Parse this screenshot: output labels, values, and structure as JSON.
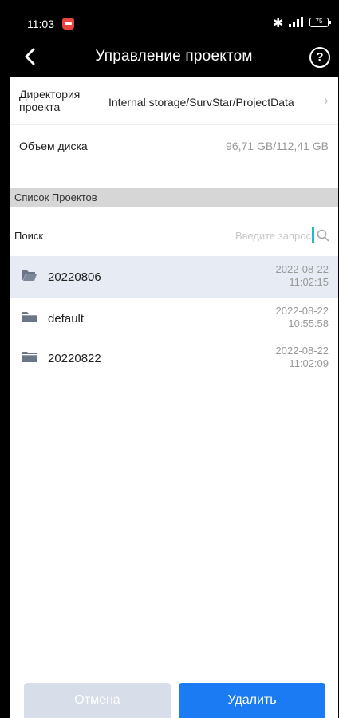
{
  "status_bar": {
    "time": "11:03",
    "battery": "75"
  },
  "header": {
    "title": "Управление проектом",
    "help": "?"
  },
  "directory": {
    "label": "Директория проекта",
    "value": "Internal storage/SurvStar/ProjectData"
  },
  "disk": {
    "label": "Объем диска",
    "value": "96,71 GB/112,41 GB"
  },
  "projects_section": {
    "title": "Список Проектов"
  },
  "search": {
    "label": "Поиск",
    "placeholder": "Введите запрос"
  },
  "projects": [
    {
      "name": "20220806",
      "date": "2022-08-22",
      "time": "11:02:15",
      "selected": true
    },
    {
      "name": "default",
      "date": "2022-08-22",
      "time": "10:55:58",
      "selected": false
    },
    {
      "name": "20220822",
      "date": "2022-08-22",
      "time": "11:02:09",
      "selected": false
    }
  ],
  "buttons": {
    "cancel": "Отмена",
    "delete": "Удалить"
  },
  "colors": {
    "accent": "#1a7bf2",
    "selected_row": "#e6ebf4",
    "section_bg": "#d6d6d6",
    "cursor": "#28b9c6"
  }
}
